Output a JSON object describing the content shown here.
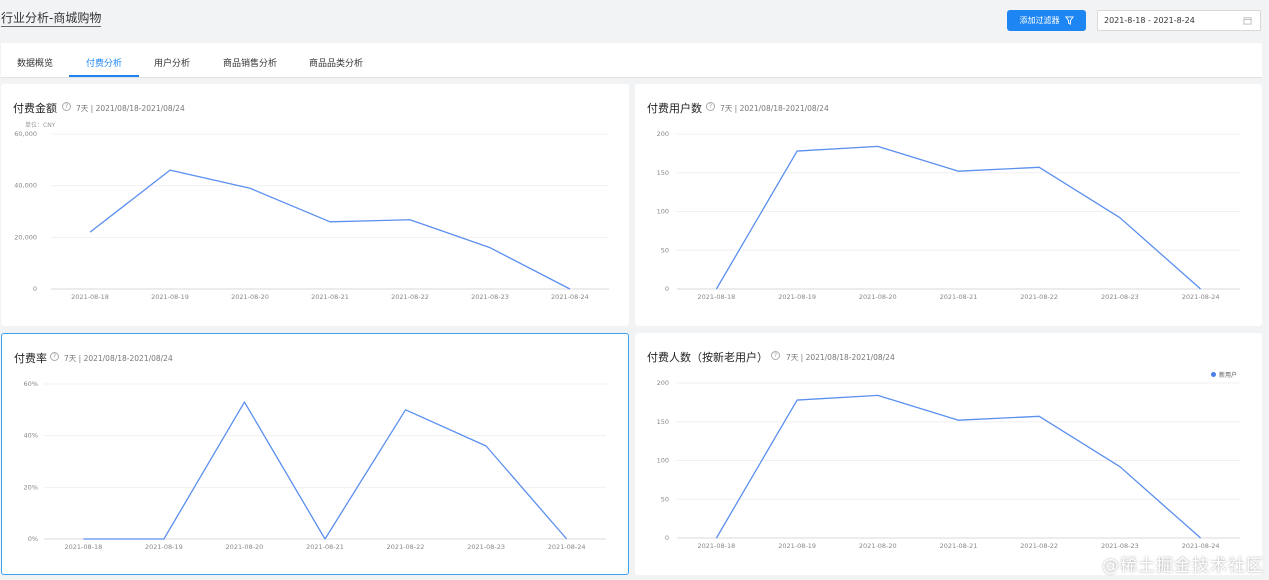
{
  "header": {
    "title": "行业分析-商城购物",
    "add_filter_label": "添加过滤器",
    "date_range": "2021-8-18 - 2021-8-24"
  },
  "tabs": [
    {
      "label": "数据概览",
      "active": false
    },
    {
      "label": "付费分析",
      "active": true
    },
    {
      "label": "用户分析",
      "active": false
    },
    {
      "label": "商品销售分析",
      "active": false
    },
    {
      "label": "商品品类分析",
      "active": false
    }
  ],
  "colors": {
    "accent": "#1e86f3",
    "line": "#5b8ff0"
  },
  "watermark": "@稀土掘金技术社区",
  "cards": [
    {
      "title": "付费金额",
      "subtitle": "7天 | 2021/08/18-2021/08/24",
      "unit": "单位：CNY",
      "legend": ""
    },
    {
      "title": "付费用户数",
      "subtitle": "7天 | 2021/08/18-2021/08/24",
      "unit": "",
      "legend": ""
    },
    {
      "title": "付费率",
      "subtitle": "7天 | 2021/08/18-2021/08/24",
      "unit": "",
      "legend": ""
    },
    {
      "title": "付费人数（按新老用户）",
      "subtitle": "7天 | 2021/08/18-2021/08/24",
      "unit": "",
      "legend": "新用户"
    }
  ],
  "chart_data": [
    {
      "type": "line",
      "title": "付费金额",
      "x": [
        "2021-08-18",
        "2021-08-19",
        "2021-08-20",
        "2021-08-21",
        "2021-08-22",
        "2021-08-23",
        "2021-08-24"
      ],
      "y_ticks": [
        "0",
        "20,000",
        "40,000",
        "60,000"
      ],
      "ylim": [
        0,
        60000
      ],
      "values": [
        22000,
        46000,
        39000,
        26000,
        26800,
        16000,
        0
      ],
      "grid": true
    },
    {
      "type": "line",
      "title": "付费用户数",
      "x": [
        "2021-08-18",
        "2021-08-19",
        "2021-08-20",
        "2021-08-21",
        "2021-08-22",
        "2021-08-23",
        "2021-08-24"
      ],
      "y_ticks": [
        "0",
        "50",
        "100",
        "150",
        "200"
      ],
      "ylim": [
        0,
        200
      ],
      "values": [
        0,
        178,
        184,
        152,
        157,
        92,
        0
      ],
      "grid": true
    },
    {
      "type": "line",
      "title": "付费率",
      "x": [
        "2021-08-18",
        "2021-08-19",
        "2021-08-20",
        "2021-08-21",
        "2021-08-22",
        "2021-08-23",
        "2021-08-24"
      ],
      "y_ticks": [
        "0%",
        "20%",
        "40%",
        "60%"
      ],
      "ylim": [
        0,
        60
      ],
      "values": [
        0,
        0,
        53,
        0,
        50,
        36,
        0
      ],
      "grid": true
    },
    {
      "type": "line",
      "title": "付费人数（按新老用户）",
      "x": [
        "2021-08-18",
        "2021-08-19",
        "2021-08-20",
        "2021-08-21",
        "2021-08-22",
        "2021-08-23",
        "2021-08-24"
      ],
      "y_ticks": [
        "0",
        "50",
        "100",
        "150",
        "200"
      ],
      "ylim": [
        0,
        200
      ],
      "series": [
        {
          "name": "新用户",
          "values": [
            0,
            178,
            184,
            152,
            157,
            92,
            0
          ]
        }
      ],
      "values": [
        0,
        178,
        184,
        152,
        157,
        92,
        0
      ],
      "legend": "top-right",
      "grid": true
    }
  ]
}
